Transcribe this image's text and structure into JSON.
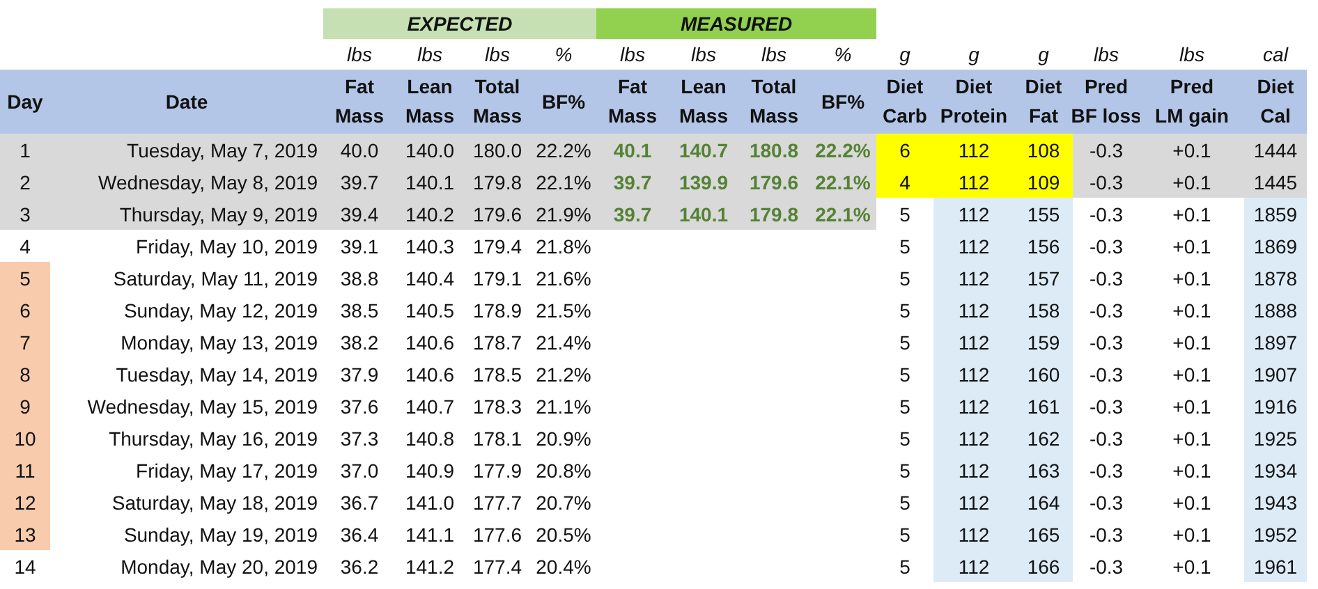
{
  "groups": [
    {
      "label": "EXPECTED",
      "kind": "expected"
    },
    {
      "label": "MEASURED",
      "kind": "measured"
    }
  ],
  "columns": [
    {
      "header": [
        "Day"
      ]
    },
    {
      "header": [
        "Date"
      ]
    },
    {
      "unit": "lbs",
      "header": [
        "Fat",
        "Mass"
      ]
    },
    {
      "unit": "lbs",
      "header": [
        "Lean",
        "Mass"
      ]
    },
    {
      "unit": "lbs",
      "header": [
        "Total",
        "Mass"
      ]
    },
    {
      "unit": "%",
      "header": [
        "BF%"
      ]
    },
    {
      "unit": "lbs",
      "header": [
        "Fat",
        "Mass"
      ]
    },
    {
      "unit": "lbs",
      "header": [
        "Lean",
        "Mass"
      ]
    },
    {
      "unit": "lbs",
      "header": [
        "Total",
        "Mass"
      ]
    },
    {
      "unit": "%",
      "header": [
        "BF%"
      ]
    },
    {
      "unit": "g",
      "header": [
        "Diet",
        "Carb"
      ]
    },
    {
      "unit": "g",
      "header": [
        "Diet",
        "Protein"
      ]
    },
    {
      "unit": "g",
      "header": [
        "Diet",
        "Fat"
      ]
    },
    {
      "unit": "lbs",
      "header": [
        "Pred",
        "BF loss"
      ]
    },
    {
      "unit": "lbs",
      "header": [
        "Pred",
        "LM gain"
      ]
    },
    {
      "unit": "cal",
      "header": [
        "Diet",
        "Cal"
      ]
    }
  ],
  "rows": [
    {
      "day": "1",
      "date": "Tuesday, May 7, 2019",
      "expected": [
        "40.0",
        "140.0",
        "180.0",
        "22.2%"
      ],
      "measured": [
        "40.1",
        "140.7",
        "180.8",
        "22.2%"
      ],
      "plan": [
        "6",
        "112",
        "108",
        "-0.3",
        "+0.1",
        "1444"
      ],
      "kind": "recorded",
      "flagged": false
    },
    {
      "day": "2",
      "date": "Wednesday, May 8, 2019",
      "expected": [
        "39.7",
        "140.1",
        "179.8",
        "22.1%"
      ],
      "measured": [
        "39.7",
        "139.9",
        "179.6",
        "22.1%"
      ],
      "plan": [
        "4",
        "112",
        "109",
        "-0.3",
        "+0.1",
        "1445"
      ],
      "kind": "recorded",
      "flagged": false
    },
    {
      "day": "3",
      "date": "Thursday, May 9, 2019",
      "expected": [
        "39.4",
        "140.2",
        "179.6",
        "21.9%"
      ],
      "measured": [
        "39.7",
        "140.1",
        "179.8",
        "22.1%"
      ],
      "plan": [
        "5",
        "112",
        "155",
        "-0.3",
        "+0.1",
        "1859"
      ],
      "kind": "measured",
      "flagged": false
    },
    {
      "day": "4",
      "date": "Friday, May 10, 2019",
      "expected": [
        "39.1",
        "140.3",
        "179.4",
        "21.8%"
      ],
      "plan": [
        "5",
        "112",
        "156",
        "-0.3",
        "+0.1",
        "1869"
      ],
      "kind": "planned",
      "flagged": false
    },
    {
      "day": "5",
      "date": "Saturday, May 11, 2019",
      "expected": [
        "38.8",
        "140.4",
        "179.1",
        "21.6%"
      ],
      "plan": [
        "5",
        "112",
        "157",
        "-0.3",
        "+0.1",
        "1878"
      ],
      "kind": "planned",
      "flagged": true
    },
    {
      "day": "6",
      "date": "Sunday, May 12, 2019",
      "expected": [
        "38.5",
        "140.5",
        "178.9",
        "21.5%"
      ],
      "plan": [
        "5",
        "112",
        "158",
        "-0.3",
        "+0.1",
        "1888"
      ],
      "kind": "planned",
      "flagged": true
    },
    {
      "day": "7",
      "date": "Monday, May 13, 2019",
      "expected": [
        "38.2",
        "140.6",
        "178.7",
        "21.4%"
      ],
      "plan": [
        "5",
        "112",
        "159",
        "-0.3",
        "+0.1",
        "1897"
      ],
      "kind": "planned",
      "flagged": true
    },
    {
      "day": "8",
      "date": "Tuesday, May 14, 2019",
      "expected": [
        "37.9",
        "140.6",
        "178.5",
        "21.2%"
      ],
      "plan": [
        "5",
        "112",
        "160",
        "-0.3",
        "+0.1",
        "1907"
      ],
      "kind": "planned",
      "flagged": true
    },
    {
      "day": "9",
      "date": "Wednesday, May 15, 2019",
      "expected": [
        "37.6",
        "140.7",
        "178.3",
        "21.1%"
      ],
      "plan": [
        "5",
        "112",
        "161",
        "-0.3",
        "+0.1",
        "1916"
      ],
      "kind": "planned",
      "flagged": true
    },
    {
      "day": "10",
      "date": "Thursday, May 16, 2019",
      "expected": [
        "37.3",
        "140.8",
        "178.1",
        "20.9%"
      ],
      "plan": [
        "5",
        "112",
        "162",
        "-0.3",
        "+0.1",
        "1925"
      ],
      "kind": "planned",
      "flagged": true
    },
    {
      "day": "11",
      "date": "Friday, May 17, 2019",
      "expected": [
        "37.0",
        "140.9",
        "177.9",
        "20.8%"
      ],
      "plan": [
        "5",
        "112",
        "163",
        "-0.3",
        "+0.1",
        "1934"
      ],
      "kind": "planned",
      "flagged": true
    },
    {
      "day": "12",
      "date": "Saturday, May 18, 2019",
      "expected": [
        "36.7",
        "141.0",
        "177.7",
        "20.7%"
      ],
      "plan": [
        "5",
        "112",
        "164",
        "-0.3",
        "+0.1",
        "1943"
      ],
      "kind": "planned",
      "flagged": true
    },
    {
      "day": "13",
      "date": "Sunday, May 19, 2019",
      "expected": [
        "36.4",
        "141.1",
        "177.6",
        "20.5%"
      ],
      "plan": [
        "5",
        "112",
        "165",
        "-0.3",
        "+0.1",
        "1952"
      ],
      "kind": "planned",
      "flagged": true
    },
    {
      "day": "14",
      "date": "Monday, May 20, 2019",
      "expected": [
        "36.2",
        "141.2",
        "177.4",
        "20.4%"
      ],
      "plan": [
        "5",
        "112",
        "166",
        "-0.3",
        "+0.1",
        "1961"
      ],
      "kind": "planned",
      "flagged": false
    }
  ]
}
